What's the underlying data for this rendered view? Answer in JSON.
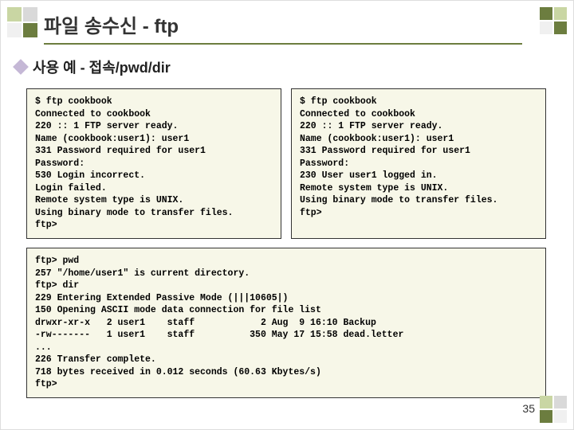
{
  "title": "파일 송수신 - ftp",
  "bullet": "사용 예 - 접속/pwd/dir",
  "panel_left": "$ ftp cookbook\nConnected to cookbook\n220 :: 1 FTP server ready.\nName (cookbook:user1): user1\n331 Password required for user1\nPassword:\n530 Login incorrect.\nLogin failed.\nRemote system type is UNIX.\nUsing binary mode to transfer files.\nftp>",
  "panel_right": "$ ftp cookbook\nConnected to cookbook\n220 :: 1 FTP server ready.\nName (cookbook:user1): user1\n331 Password required for user1\nPassword:\n230 User user1 logged in.\nRemote system type is UNIX.\nUsing binary mode to transfer files.\nftp>",
  "panel_wide": "ftp> pwd\n257 \"/home/user1\" is current directory.\nftp> dir\n229 Entering Extended Passive Mode (|||10605|)\n150 Opening ASCII mode data connection for file list\ndrwxr-xr-x   2 user1    staff            2 Aug  9 16:10 Backup\n-rw-------   1 user1    staff          350 May 17 15:58 dead.letter\n...\n226 Transfer complete.\n718 bytes received in 0.012 seconds (60.63 Kbytes/s)\nftp>",
  "page_number": "35"
}
